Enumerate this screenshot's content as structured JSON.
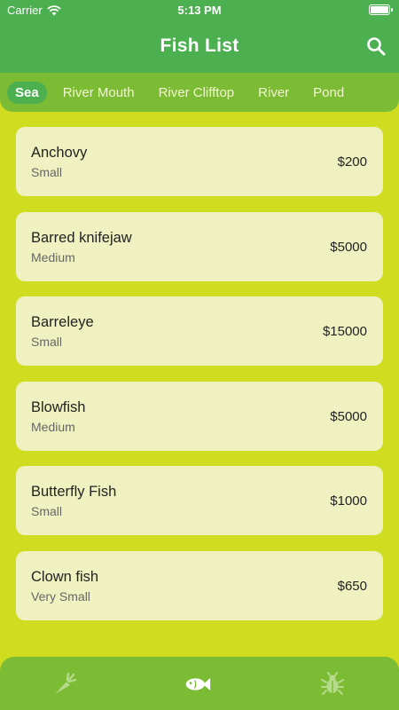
{
  "status_bar": {
    "carrier": "Carrier",
    "time": "5:13 PM"
  },
  "header": {
    "title": "Fish List"
  },
  "tabs": [
    {
      "label": "Sea",
      "active": true
    },
    {
      "label": "River Mouth",
      "active": false
    },
    {
      "label": "River Clifftop",
      "active": false
    },
    {
      "label": "River",
      "active": false
    },
    {
      "label": "Pond",
      "active": false
    }
  ],
  "fish": [
    {
      "name": "Anchovy",
      "size": "Small",
      "price": "$200"
    },
    {
      "name": "Barred knifejaw",
      "size": "Medium",
      "price": "$5000"
    },
    {
      "name": "Barreleye",
      "size": "Small",
      "price": "$15000"
    },
    {
      "name": "Blowfish",
      "size": "Medium",
      "price": "$5000"
    },
    {
      "name": "Butterfly Fish",
      "size": "Small",
      "price": "$1000"
    },
    {
      "name": "Clown fish",
      "size": "Very Small",
      "price": "$650"
    }
  ],
  "bottom_nav": [
    {
      "icon": "carrot-icon",
      "active": false
    },
    {
      "icon": "fish-icon",
      "active": true
    },
    {
      "icon": "bug-icon",
      "active": false
    }
  ],
  "colors": {
    "header": "#4caf50",
    "tabbar": "#7cbb34",
    "background": "#d0dc1f",
    "card": "#eff2c0"
  }
}
